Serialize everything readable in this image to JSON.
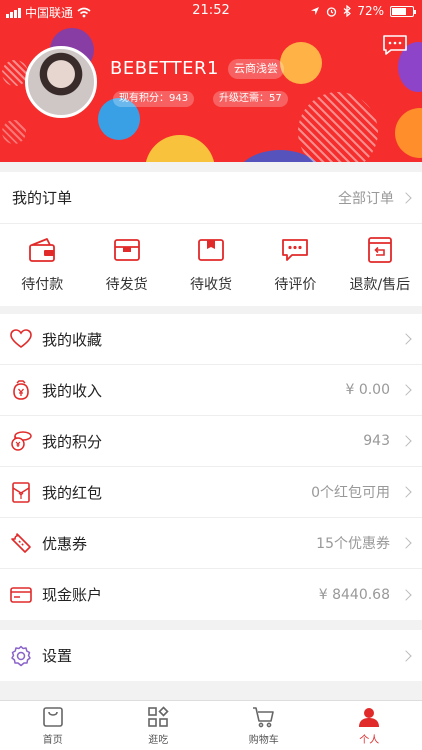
{
  "status_bar": {
    "carrier": "中国联通",
    "time": "21:52",
    "battery": "72%",
    "battery_level": 0.72
  },
  "profile": {
    "username": "BEBETTER1",
    "level_tag": "云商浅尝",
    "points_text": "现有积分：943",
    "upgrade_text": "升级还需：57"
  },
  "orders": {
    "title": "我的订单",
    "all_label": "全部订单",
    "items": [
      {
        "label": "待付款",
        "icon": "wallet-icon"
      },
      {
        "label": "待发货",
        "icon": "box-icon"
      },
      {
        "label": "待收货",
        "icon": "package-icon"
      },
      {
        "label": "待评价",
        "icon": "comment-icon"
      },
      {
        "label": "退款/售后",
        "icon": "return-icon"
      }
    ]
  },
  "menu": {
    "items": [
      {
        "label": "我的收藏",
        "value": "",
        "icon": "heart-icon"
      },
      {
        "label": "我的收入",
        "value": "¥ 0.00",
        "icon": "income-icon"
      },
      {
        "label": "我的积分",
        "value": "943",
        "icon": "coins-icon"
      },
      {
        "label": "我的红包",
        "value": "0个红包可用",
        "icon": "red-envelope-icon"
      },
      {
        "label": "优惠券",
        "value": "15个优惠券",
        "icon": "coupon-icon"
      },
      {
        "label": "现金账户",
        "value": "¥ 8440.68",
        "icon": "card-icon"
      }
    ],
    "settings_label": "设置"
  },
  "tabbar": {
    "tabs": [
      {
        "label": "首页",
        "icon": "home-bag-icon"
      },
      {
        "label": "逛吃",
        "icon": "grid-icon"
      },
      {
        "label": "购物车",
        "icon": "cart-icon"
      },
      {
        "label": "个人",
        "icon": "person-icon"
      }
    ],
    "active_index": 3
  },
  "colors": {
    "brand_red": "#f52d2d",
    "accent_red": "#e12a2a"
  }
}
